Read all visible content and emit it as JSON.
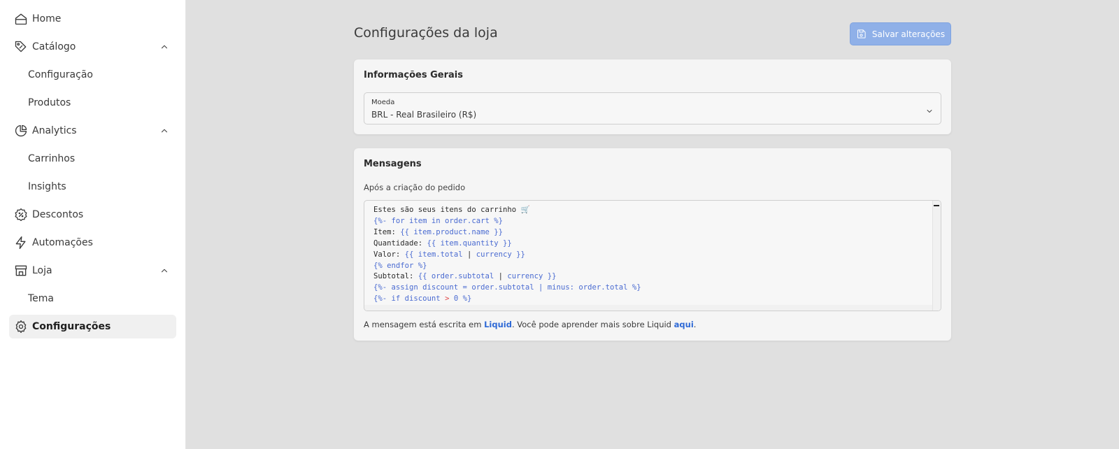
{
  "sidebar": {
    "items": [
      {
        "label": "Home",
        "icon": "home-icon"
      },
      {
        "label": "Catálogo",
        "icon": "tag-icon"
      },
      {
        "label": "Configuração"
      },
      {
        "label": "Produtos"
      },
      {
        "label": "Analytics",
        "icon": "pie-chart-icon"
      },
      {
        "label": "Carrinhos"
      },
      {
        "label": "Insights"
      },
      {
        "label": "Descontos",
        "icon": "discount-badge-icon"
      },
      {
        "label": "Automações",
        "icon": "lightning-icon"
      },
      {
        "label": "Loja",
        "icon": "store-icon"
      },
      {
        "label": "Tema"
      },
      {
        "label": "Configurações",
        "icon": "gear-icon"
      }
    ]
  },
  "header": {
    "title": "Configurações da loja",
    "save_label": "Salvar alterações"
  },
  "general": {
    "title": "Informações Gerais",
    "currency_label": "Moeda",
    "currency_value": "BRL - Real Brasileiro (R$)"
  },
  "messages": {
    "title": "Mensagens",
    "field_label": "Após a criação do pedido",
    "code_lines": [
      "Estes são seus itens do carrinho 🛒",
      "{%- for item in order.cart %}",
      "Item: {{ item.product.name }}",
      "Quantidade: {{ item.quantity }}",
      "Valor: {{ item.total | currency }}",
      "{% endfor %}",
      "Subtotal: {{ order.subtotal | currency }}",
      "{%- assign discount = order.subtotal | minus: order.total %}",
      "{%- if discount > 0 %}"
    ],
    "help_prefix": "A mensagem está escrita em ",
    "help_link1": "Liquid",
    "help_middle": ". Você pode aprender mais sobre Liquid ",
    "help_link2": "aqui",
    "help_suffix": "."
  },
  "colors": {
    "accent": "#8fb0e8",
    "link": "#2f6ad6",
    "keyword": "#4a6bd1",
    "operator": "#e04a4a"
  }
}
